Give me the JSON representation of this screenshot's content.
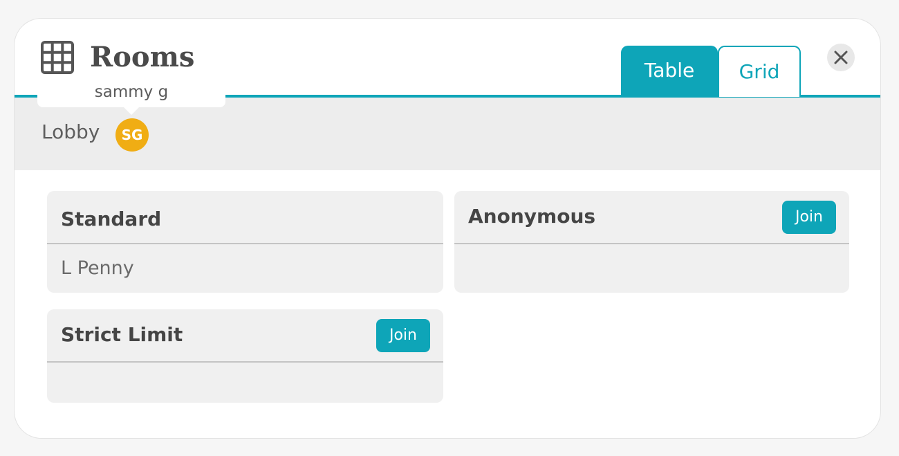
{
  "header": {
    "title": "Rooms",
    "tabs": [
      {
        "label": "Table",
        "active": true
      },
      {
        "label": "Grid",
        "active": false
      }
    ],
    "close_icon": "close-icon"
  },
  "lobby": {
    "label": "Lobby",
    "avatar_initials": "SG",
    "avatar_color": "#f0ad14",
    "tooltip": "sammy g"
  },
  "rooms": [
    {
      "name": "Standard",
      "members": [
        "L Penny"
      ],
      "join_label": ""
    },
    {
      "name": "Anonymous",
      "members": [],
      "join_label": "Join"
    },
    {
      "name": "Strict Limit",
      "members": [],
      "join_label": "Join"
    }
  ],
  "colors": {
    "accent": "#0ea5b8",
    "avatar": "#f0ad14"
  }
}
